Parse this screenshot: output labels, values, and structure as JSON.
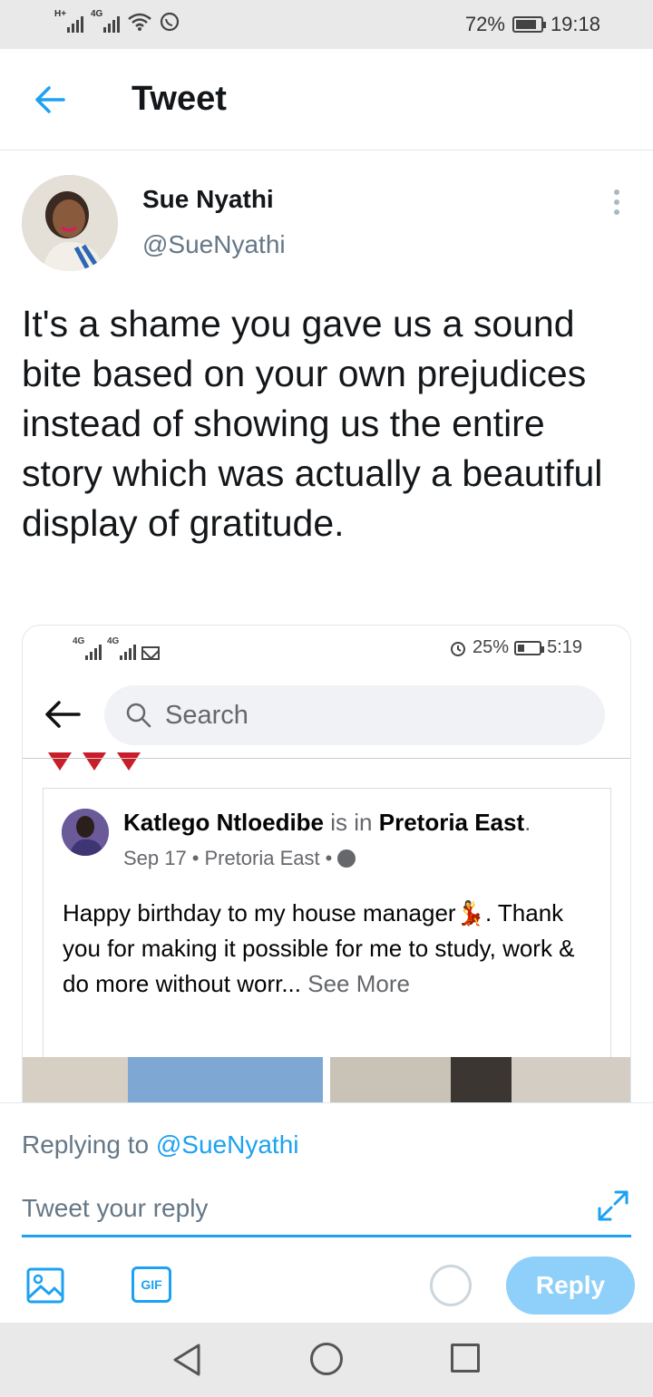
{
  "status_bar": {
    "network_1": "H+",
    "network_2": "4G",
    "battery": "72%",
    "time": "19:18"
  },
  "header": {
    "title": "Tweet"
  },
  "tweet": {
    "author_name": "Sue Nyathi",
    "author_handle": "@SueNyathi",
    "text": "It's a shame you gave us a sound bite based on your own prejudices instead of showing us the entire story which was actually a beautiful display of gratitude."
  },
  "embedded_screenshot": {
    "status_bar": {
      "network_1": "4G",
      "network_2": "4G",
      "battery": "25%",
      "time": "5:19"
    },
    "search_placeholder": "Search",
    "post": {
      "author": "Katlego Ntloedibe",
      "is_in": "is in",
      "location": "Pretoria East",
      "date": "Sep 17",
      "meta_location": "Pretoria East",
      "text": "Happy birthday to my house manager💃. Thank you for making it possible for me to study, work & do more without worr...",
      "see_more": "See More"
    }
  },
  "reply": {
    "replying_to_label": "Replying to",
    "replying_to_handle": "@SueNyathi",
    "placeholder": "Tweet your reply",
    "gif_label": "GIF",
    "reply_button": "Reply"
  },
  "icons": {
    "back": "arrow-left-icon",
    "more": "more-vertical-icon",
    "expand": "expand-icon",
    "image": "image-icon",
    "gif": "gif-icon"
  },
  "colors": {
    "accent": "#1da1f2",
    "reply_button_disabled": "#8ed0f9",
    "secondary_text": "#657786"
  }
}
